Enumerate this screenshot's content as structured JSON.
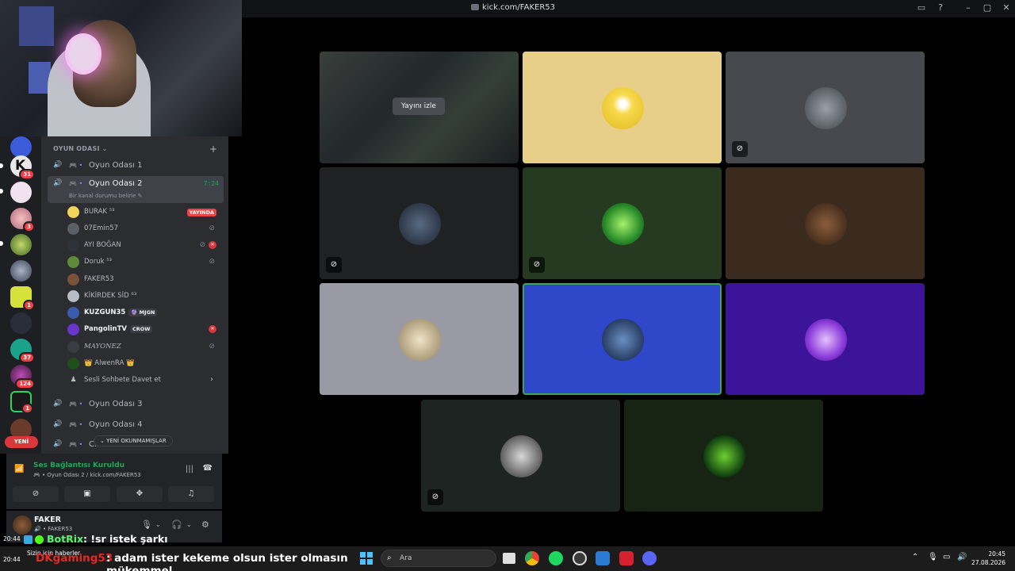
{
  "window": {
    "title": "kick.com/FAKER53"
  },
  "sidebar": {
    "category": "OYUN ODASI",
    "channels": [
      {
        "name": "Oyun Odası 1"
      },
      {
        "name": "Oyun Odası 2",
        "time": "7:24",
        "status": "Bir kanal durumu belirle"
      },
      {
        "name": "Oyun Odası 3"
      },
      {
        "name": "Oyun Odası 4"
      },
      {
        "name": "C..."
      }
    ],
    "users": [
      {
        "name": "BURAK ⁵³",
        "badge": "YAYINDA"
      },
      {
        "name": "07Emin57"
      },
      {
        "name": "AYI BOĞAN"
      },
      {
        "name": "Doruk ⁵³"
      },
      {
        "name": "FAKER53"
      },
      {
        "name": "KİKİRDEK SİD ⁶³"
      },
      {
        "name": "KUZGUN35",
        "tag": "🔮 MJGN"
      },
      {
        "name": "PangolinTV",
        "tag": "CROW"
      },
      {
        "name": "MAYONEZ"
      },
      {
        "name": "👑 AlwenRA 👑"
      },
      {
        "name": "Sesli Sohbete Davet et"
      }
    ],
    "unread_pill": "YENİ OKUNMAMIŞLAR",
    "new_label": "YENİ"
  },
  "server_badges": [
    "31",
    "3",
    "1",
    "37",
    "124",
    "1"
  ],
  "voice_panel": {
    "status": "Ses Bağlantısı Kuruldu",
    "location": "Oyun Odası 2 / kick.com/FAKER53"
  },
  "user_panel": {
    "name": "FAKER",
    "status": "FAKER53"
  },
  "stage": {
    "watch_label": "Yayını izle"
  },
  "chat": [
    {
      "time": "20:44",
      "user": "BotRix",
      "text": ": !sr istek şarkı"
    },
    {
      "time": "20:44",
      "user": "DKgaming53",
      "text": ": adam ister kekeme olsun ister olmasın mükemmel"
    }
  ],
  "taskbar": {
    "news": "Sizin için haberler",
    "search_placeholder": "Ara",
    "time": "20:45",
    "date": "27.08.2026"
  },
  "colors": {
    "accent_green": "#23a55a",
    "live_red": "#ed4245",
    "kick_green": "#53fc18"
  }
}
